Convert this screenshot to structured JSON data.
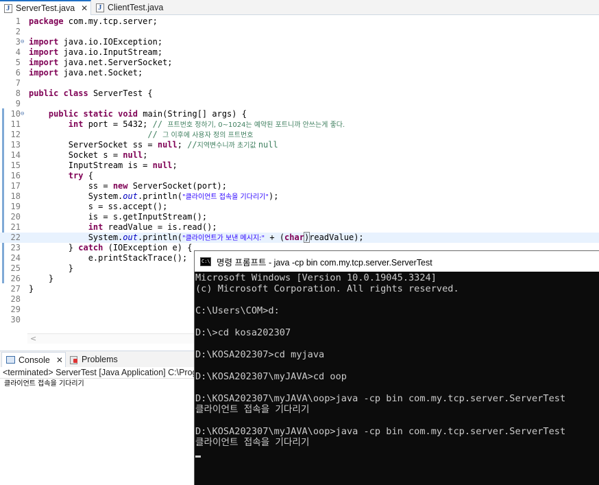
{
  "editor": {
    "tabs": [
      {
        "label": "ServerTest.java",
        "active": true,
        "close": "✕"
      },
      {
        "label": "ClientTest.java",
        "active": false
      }
    ],
    "lines": [
      {
        "n": "1",
        "code": [
          {
            "t": "kw",
            "v": "package"
          },
          {
            "t": "",
            "v": " com.my.tcp.server;"
          }
        ]
      },
      {
        "n": "2",
        "code": []
      },
      {
        "n": "3",
        "fold": true,
        "code": [
          {
            "t": "kw",
            "v": "import"
          },
          {
            "t": "",
            "v": " java.io.IOException;"
          }
        ]
      },
      {
        "n": "4",
        "code": [
          {
            "t": "kw",
            "v": "import"
          },
          {
            "t": "",
            "v": " java.io.InputStream;"
          }
        ]
      },
      {
        "n": "5",
        "code": [
          {
            "t": "kw",
            "v": "import"
          },
          {
            "t": "",
            "v": " java.net.ServerSocket;"
          }
        ]
      },
      {
        "n": "6",
        "code": [
          {
            "t": "kw",
            "v": "import"
          },
          {
            "t": "",
            "v": " java.net.Socket;"
          }
        ]
      },
      {
        "n": "7",
        "code": []
      },
      {
        "n": "8",
        "code": [
          {
            "t": "kw",
            "v": "public"
          },
          {
            "t": "",
            "v": " "
          },
          {
            "t": "kw",
            "v": "class"
          },
          {
            "t": "",
            "v": " ServerTest {"
          }
        ]
      },
      {
        "n": "9",
        "code": []
      },
      {
        "n": "10",
        "fold": true,
        "code": [
          {
            "t": "",
            "v": "    "
          },
          {
            "t": "kw",
            "v": "public"
          },
          {
            "t": "",
            "v": " "
          },
          {
            "t": "kw",
            "v": "static"
          },
          {
            "t": "",
            "v": " "
          },
          {
            "t": "kw",
            "v": "void"
          },
          {
            "t": "",
            "v": " main(String[] args) {"
          }
        ]
      },
      {
        "n": "11",
        "code": [
          {
            "t": "",
            "v": "        "
          },
          {
            "t": "kw",
            "v": "int"
          },
          {
            "t": "",
            "v": " port = 5432; "
          },
          {
            "t": "cm",
            "v": "// "
          },
          {
            "t": "cmk",
            "v": "프트번호 정하기, 0~1024는 예약된 포트니까 안쓰는게 좋다."
          }
        ]
      },
      {
        "n": "12",
        "code": [
          {
            "t": "",
            "v": "                        "
          },
          {
            "t": "cm",
            "v": "// "
          },
          {
            "t": "cmk",
            "v": "그 이후에 사용자 정의 프트번호"
          }
        ]
      },
      {
        "n": "13",
        "code": [
          {
            "t": "",
            "v": "        ServerSocket ss = "
          },
          {
            "t": "kw",
            "v": "null"
          },
          {
            "t": "",
            "v": "; "
          },
          {
            "t": "cm",
            "v": "//"
          },
          {
            "t": "cmk",
            "v": "지역변수니까 초기값 "
          },
          {
            "t": "cm",
            "v": "null"
          }
        ]
      },
      {
        "n": "14",
        "code": [
          {
            "t": "",
            "v": "        Socket s = "
          },
          {
            "t": "kw",
            "v": "null"
          },
          {
            "t": "",
            "v": ";"
          }
        ]
      },
      {
        "n": "15",
        "code": [
          {
            "t": "",
            "v": "        InputStream is = "
          },
          {
            "t": "kw",
            "v": "null"
          },
          {
            "t": "",
            "v": ";"
          }
        ]
      },
      {
        "n": "16",
        "code": [
          {
            "t": "",
            "v": "        "
          },
          {
            "t": "kw",
            "v": "try"
          },
          {
            "t": "",
            "v": " {"
          }
        ]
      },
      {
        "n": "17",
        "code": [
          {
            "t": "",
            "v": "            ss = "
          },
          {
            "t": "kw",
            "v": "new"
          },
          {
            "t": "",
            "v": " ServerSocket(port);"
          }
        ]
      },
      {
        "n": "18",
        "code": [
          {
            "t": "",
            "v": "            System."
          },
          {
            "t": "fld",
            "v": "out"
          },
          {
            "t": "",
            "v": ".println("
          },
          {
            "t": "strk",
            "v": "\"클라이언트 접속을 기다리기\""
          },
          {
            "t": "",
            "v": ");"
          }
        ]
      },
      {
        "n": "19",
        "code": [
          {
            "t": "",
            "v": "            s = ss.accept();"
          }
        ]
      },
      {
        "n": "20",
        "code": [
          {
            "t": "",
            "v": "            is = s.getInputStream();"
          }
        ]
      },
      {
        "n": "21",
        "code": [
          {
            "t": "",
            "v": "            "
          },
          {
            "t": "kw",
            "v": "int"
          },
          {
            "t": "",
            "v": " readValue = is.read();"
          }
        ]
      },
      {
        "n": "22",
        "current": true,
        "code": [
          {
            "t": "",
            "v": "            System."
          },
          {
            "t": "fld",
            "v": "out"
          },
          {
            "t": "",
            "v": ".println("
          },
          {
            "t": "strk",
            "v": "\"클라이언트가 보낸 메시지:\""
          },
          {
            "t": "",
            "v": " + ("
          },
          {
            "t": "kw",
            "v": "char"
          },
          {
            "t": "box",
            "v": ")"
          },
          {
            "t": "",
            "v": "readValue);"
          }
        ]
      },
      {
        "n": "23",
        "code": [
          {
            "t": "",
            "v": "        } "
          },
          {
            "t": "kw",
            "v": "catch"
          },
          {
            "t": "",
            "v": " (IOException e) {"
          }
        ]
      },
      {
        "n": "24",
        "code": [
          {
            "t": "",
            "v": "            e.printStackTrace();"
          }
        ]
      },
      {
        "n": "25",
        "code": [
          {
            "t": "",
            "v": "        }"
          }
        ]
      },
      {
        "n": "26",
        "code": [
          {
            "t": "",
            "v": "    }"
          }
        ]
      },
      {
        "n": "27",
        "code": [
          {
            "t": "",
            "v": "}"
          }
        ]
      },
      {
        "n": "28",
        "code": []
      },
      {
        "n": "29",
        "code": []
      },
      {
        "n": "30",
        "code": []
      }
    ],
    "scroll_arrow": "<"
  },
  "console_view": {
    "tabs": {
      "console": "Console",
      "console_close": "✕",
      "problems": "Problems"
    },
    "status": "<terminated> ServerTest [Java Application] C:\\Prog",
    "output": "클라이언트 접속을 기다리기"
  },
  "cmd": {
    "title": "명령 프롬프트 - java  -cp bin com.my.tcp.server.ServerTest",
    "lines": [
      "Microsoft Windows [Version 10.0.19045.3324]",
      "(c) Microsoft Corporation. All rights reserved.",
      "",
      "C:\\Users\\COM>d:",
      "",
      "D:\\>cd kosa202307",
      "",
      "D:\\KOSA202307>cd myjava",
      "",
      "D:\\KOSA202307\\myJAVA>cd oop",
      "",
      "D:\\KOSA202307\\myJAVA\\oop>java -cp bin com.my.tcp.server.ServerTest",
      "클라이언트 접속을 기다리기",
      "",
      "D:\\KOSA202307\\myJAVA\\oop>java -cp bin com.my.tcp.server.ServerTest",
      "클라이언트 접속을 기다리기",
      ""
    ]
  }
}
